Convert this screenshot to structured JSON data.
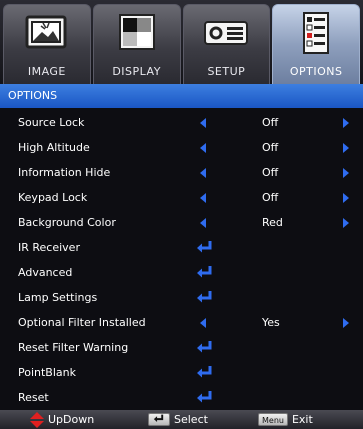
{
  "tabs": [
    {
      "label": "IMAGE",
      "icon": "picture-icon",
      "active": false
    },
    {
      "label": "DISPLAY",
      "icon": "display-icon",
      "active": false
    },
    {
      "label": "SETUP",
      "icon": "projector-icon",
      "active": false
    },
    {
      "label": "OPTIONS",
      "icon": "checklist-icon",
      "active": true
    }
  ],
  "title": "OPTIONS",
  "rows": [
    {
      "label": "Source Lock",
      "type": "toggle",
      "value": "Off"
    },
    {
      "label": "High Altitude",
      "type": "toggle",
      "value": "Off"
    },
    {
      "label": "Information Hide",
      "type": "toggle",
      "value": "Off"
    },
    {
      "label": "Keypad Lock",
      "type": "toggle",
      "value": "Off"
    },
    {
      "label": "Background Color",
      "type": "toggle",
      "value": "Red"
    },
    {
      "label": "IR Receiver",
      "type": "enter"
    },
    {
      "label": "Advanced",
      "type": "enter"
    },
    {
      "label": "Lamp Settings",
      "type": "enter"
    },
    {
      "label": "Optional Filter Installed",
      "type": "toggle",
      "value": "Yes"
    },
    {
      "label": "Reset Filter Warning",
      "type": "enter"
    },
    {
      "label": "PointBlank",
      "type": "enter"
    },
    {
      "label": "Reset",
      "type": "enter"
    }
  ],
  "footer": {
    "updown_label": "UpDown",
    "select_label": "Select",
    "exit_label": "Exit",
    "menu_key": "Menu"
  },
  "colors": {
    "accent": "#2f6cf0",
    "title_bar": "#1a56c4",
    "updown_arrow": "#e02020"
  }
}
